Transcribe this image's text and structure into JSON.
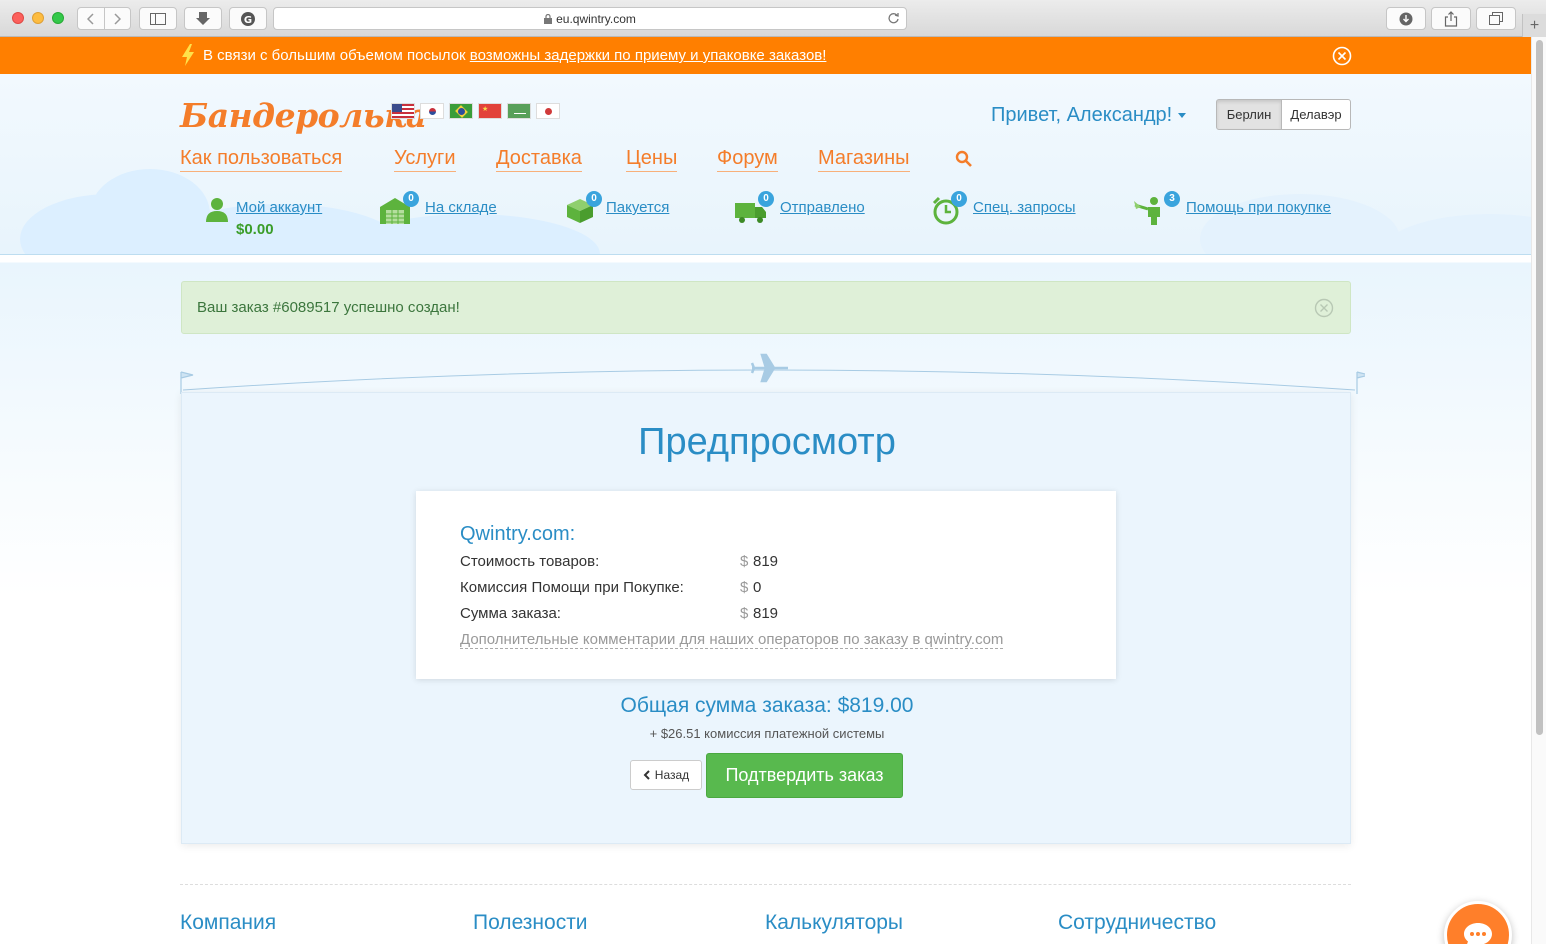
{
  "browser": {
    "url": "eu.qwintry.com"
  },
  "notice": {
    "text": "В связи с большим объемом посылок ",
    "link": "возможны задержки по приему и упаковке заказов!"
  },
  "header": {
    "logo": "Бандеролька",
    "greeting": "Привет, Александр!",
    "warehouses": [
      "Берлин",
      "Делавэр"
    ],
    "nav": [
      "Как пользоваться",
      "Услуги",
      "Доставка",
      "Цены",
      "Форум",
      "Магазины"
    ]
  },
  "status": {
    "account_label": "Мой аккаунт",
    "balance": "$0.00",
    "items": [
      {
        "label": "На складе",
        "count": "0",
        "icon": "warehouse-icon"
      },
      {
        "label": "Пакуется",
        "count": "0",
        "icon": "box-icon"
      },
      {
        "label": "Отправлено",
        "count": "0",
        "icon": "truck-icon"
      },
      {
        "label": "Спец. запросы",
        "count": "0",
        "icon": "alarm-clock-icon"
      },
      {
        "label": "Помощь при покупке",
        "count": "3",
        "icon": "shopping-help-icon"
      }
    ]
  },
  "alert": {
    "text": "Ваш заказ #6089517 успешно создан!"
  },
  "preview": {
    "title": "Предпросмотр",
    "store": "Qwintry.com:",
    "currency_symbol": "$",
    "rows": [
      {
        "label": "Стоимость товаров:",
        "value": "819"
      },
      {
        "label": "Комиссия Помощи при Покупке:",
        "value": "0"
      },
      {
        "label": "Сумма заказа:",
        "value": "819"
      }
    ],
    "comment_link": "Дополнительные комментарии для наших операторов по заказу в qwintry.com",
    "total": "Общая сумма заказа: $819.00",
    "fee": "+ $26.51 комиссия платежной системы",
    "back_label": "Назад",
    "confirm_label": "Подтвердить заказ"
  },
  "footer": {
    "headings": [
      "Компания",
      "Полезности",
      "Калькуляторы",
      "Сотрудничество"
    ]
  },
  "colors": {
    "accent_orange": "#ff7f00",
    "link_blue": "#2a8dc5",
    "confirm_green": "#58b94e"
  }
}
